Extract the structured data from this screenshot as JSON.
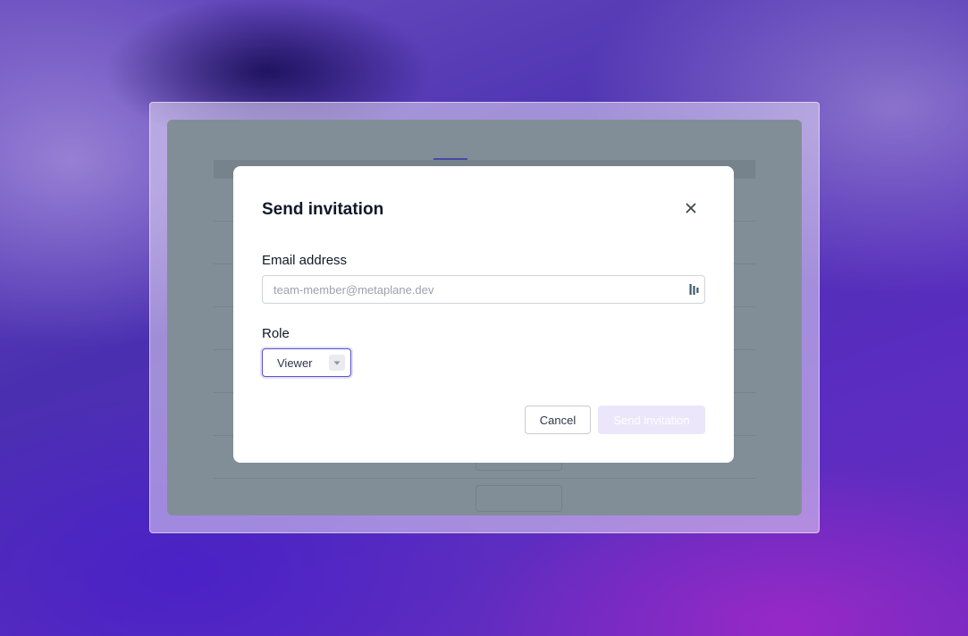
{
  "modal": {
    "title": "Send invitation",
    "close_icon": "close-icon",
    "email": {
      "label": "Email address",
      "placeholder": "team-member@metaplane.dev",
      "value": "",
      "extension_icon": "password-manager-icon"
    },
    "role": {
      "label": "Role",
      "selected": "Viewer",
      "icon": "chevron-down-icon"
    },
    "actions": {
      "cancel_label": "Cancel",
      "submit_label": "Send invitation",
      "submit_disabled": true
    }
  },
  "colors": {
    "accent": "#5b53c8",
    "submit_disabled_bg": "#ece6fa",
    "overlay": "#818e97"
  }
}
